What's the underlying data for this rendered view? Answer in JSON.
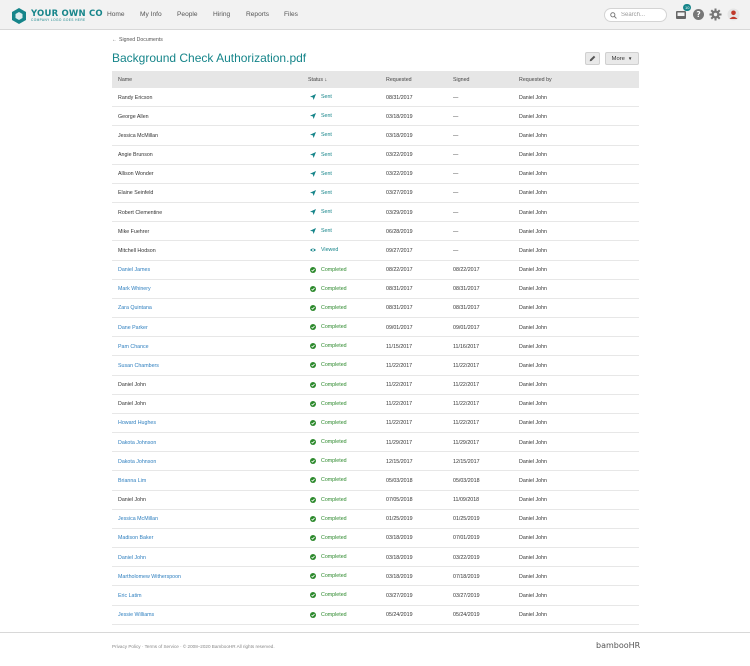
{
  "brand": {
    "name": "YOUR OWN CO",
    "tagline": "COMPANY LOGO GOES HERE",
    "accent_color": "#16858a"
  },
  "nav": {
    "items": [
      {
        "label": "Home"
      },
      {
        "label": "My Info"
      },
      {
        "label": "People"
      },
      {
        "label": "Hiring"
      },
      {
        "label": "Reports"
      },
      {
        "label": "Files"
      }
    ]
  },
  "search": {
    "placeholder": "Search..."
  },
  "header_icons": {
    "inbox_badge": "10"
  },
  "breadcrumb": {
    "label": "Signed Documents"
  },
  "page": {
    "title": "Background Check Authorization.pdf"
  },
  "actions": {
    "more_label": "More"
  },
  "table": {
    "headers": {
      "name": "Name",
      "status": "Status",
      "status_sort": "↓",
      "requested": "Requested",
      "signed": "Signed",
      "requested_by": "Requested by"
    },
    "rows": [
      {
        "name": "Randy Ericson",
        "link": false,
        "status": "Sent",
        "requested": "08/31/2017",
        "signed": "—",
        "by": "Daniel John"
      },
      {
        "name": "George Allen",
        "link": false,
        "status": "Sent",
        "requested": "03/18/2019",
        "signed": "—",
        "by": "Daniel John"
      },
      {
        "name": "Jessica McMillan",
        "link": false,
        "status": "Sent",
        "requested": "03/18/2019",
        "signed": "—",
        "by": "Daniel John"
      },
      {
        "name": "Angie Brunson",
        "link": false,
        "status": "Sent",
        "requested": "03/22/2019",
        "signed": "—",
        "by": "Daniel John"
      },
      {
        "name": "Allison Wonder",
        "link": false,
        "status": "Sent",
        "requested": "03/22/2019",
        "signed": "—",
        "by": "Daniel John"
      },
      {
        "name": "Elaine Seinfeld",
        "link": false,
        "status": "Sent",
        "requested": "03/27/2019",
        "signed": "—",
        "by": "Daniel John"
      },
      {
        "name": "Robert Clementine",
        "link": false,
        "status": "Sent",
        "requested": "03/29/2019",
        "signed": "—",
        "by": "Daniel John"
      },
      {
        "name": "Mike Fuehrer",
        "link": false,
        "status": "Sent",
        "requested": "06/28/2019",
        "signed": "—",
        "by": "Daniel John"
      },
      {
        "name": "Mitchell Hodson",
        "link": false,
        "status": "Viewed",
        "requested": "09/27/2017",
        "signed": "—",
        "by": "Daniel John"
      },
      {
        "name": "Daniel James",
        "link": true,
        "status": "Completed",
        "requested": "08/22/2017",
        "signed": "08/22/2017",
        "by": "Daniel John"
      },
      {
        "name": "Mark Whinery",
        "link": true,
        "status": "Completed",
        "requested": "08/31/2017",
        "signed": "08/31/2017",
        "by": "Daniel John"
      },
      {
        "name": "Zara Quintana",
        "link": true,
        "status": "Completed",
        "requested": "08/31/2017",
        "signed": "08/31/2017",
        "by": "Daniel John"
      },
      {
        "name": "Dane Parker",
        "link": true,
        "status": "Completed",
        "requested": "09/01/2017",
        "signed": "09/01/2017",
        "by": "Daniel John"
      },
      {
        "name": "Pam Chance",
        "link": true,
        "status": "Completed",
        "requested": "11/15/2017",
        "signed": "11/16/2017",
        "by": "Daniel John"
      },
      {
        "name": "Susan Chambers",
        "link": true,
        "status": "Completed",
        "requested": "11/22/2017",
        "signed": "11/22/2017",
        "by": "Daniel John"
      },
      {
        "name": "Daniel John",
        "link": false,
        "status": "Completed",
        "requested": "11/22/2017",
        "signed": "11/22/2017",
        "by": "Daniel John"
      },
      {
        "name": "Daniel John",
        "link": false,
        "status": "Completed",
        "requested": "11/22/2017",
        "signed": "11/22/2017",
        "by": "Daniel John"
      },
      {
        "name": "Howard Hughes",
        "link": true,
        "status": "Completed",
        "requested": "11/22/2017",
        "signed": "11/22/2017",
        "by": "Daniel John"
      },
      {
        "name": "Dakota Johnson",
        "link": true,
        "status": "Completed",
        "requested": "11/29/2017",
        "signed": "11/29/2017",
        "by": "Daniel John"
      },
      {
        "name": "Dakota Johnson",
        "link": true,
        "status": "Completed",
        "requested": "12/15/2017",
        "signed": "12/15/2017",
        "by": "Daniel John"
      },
      {
        "name": "Brianna Lim",
        "link": true,
        "status": "Completed",
        "requested": "05/03/2018",
        "signed": "05/03/2018",
        "by": "Daniel John"
      },
      {
        "name": "Daniel John",
        "link": false,
        "status": "Completed",
        "requested": "07/05/2018",
        "signed": "11/09/2018",
        "by": "Daniel John"
      },
      {
        "name": "Jessica McMillan",
        "link": true,
        "status": "Completed",
        "requested": "01/25/2019",
        "signed": "01/25/2019",
        "by": "Daniel John"
      },
      {
        "name": "Madison Baker",
        "link": true,
        "status": "Completed",
        "requested": "03/18/2019",
        "signed": "07/01/2019",
        "by": "Daniel John"
      },
      {
        "name": "Daniel John",
        "link": true,
        "status": "Completed",
        "requested": "03/18/2019",
        "signed": "03/22/2019",
        "by": "Daniel John"
      },
      {
        "name": "Martholomew Witherspoon",
        "link": true,
        "status": "Completed",
        "requested": "03/18/2019",
        "signed": "07/18/2019",
        "by": "Daniel John"
      },
      {
        "name": "Eric Latim",
        "link": true,
        "status": "Completed",
        "requested": "03/27/2019",
        "signed": "03/27/2019",
        "by": "Daniel John"
      },
      {
        "name": "Jessie Williams",
        "link": true,
        "status": "Completed",
        "requested": "05/24/2019",
        "signed": "05/24/2019",
        "by": "Daniel John"
      }
    ]
  },
  "footer": {
    "text": "Privacy Policy  ·  Terms of Service  ·  © 2008–2020 BambooHR All rights reserved.",
    "logo": "bambooHR"
  }
}
